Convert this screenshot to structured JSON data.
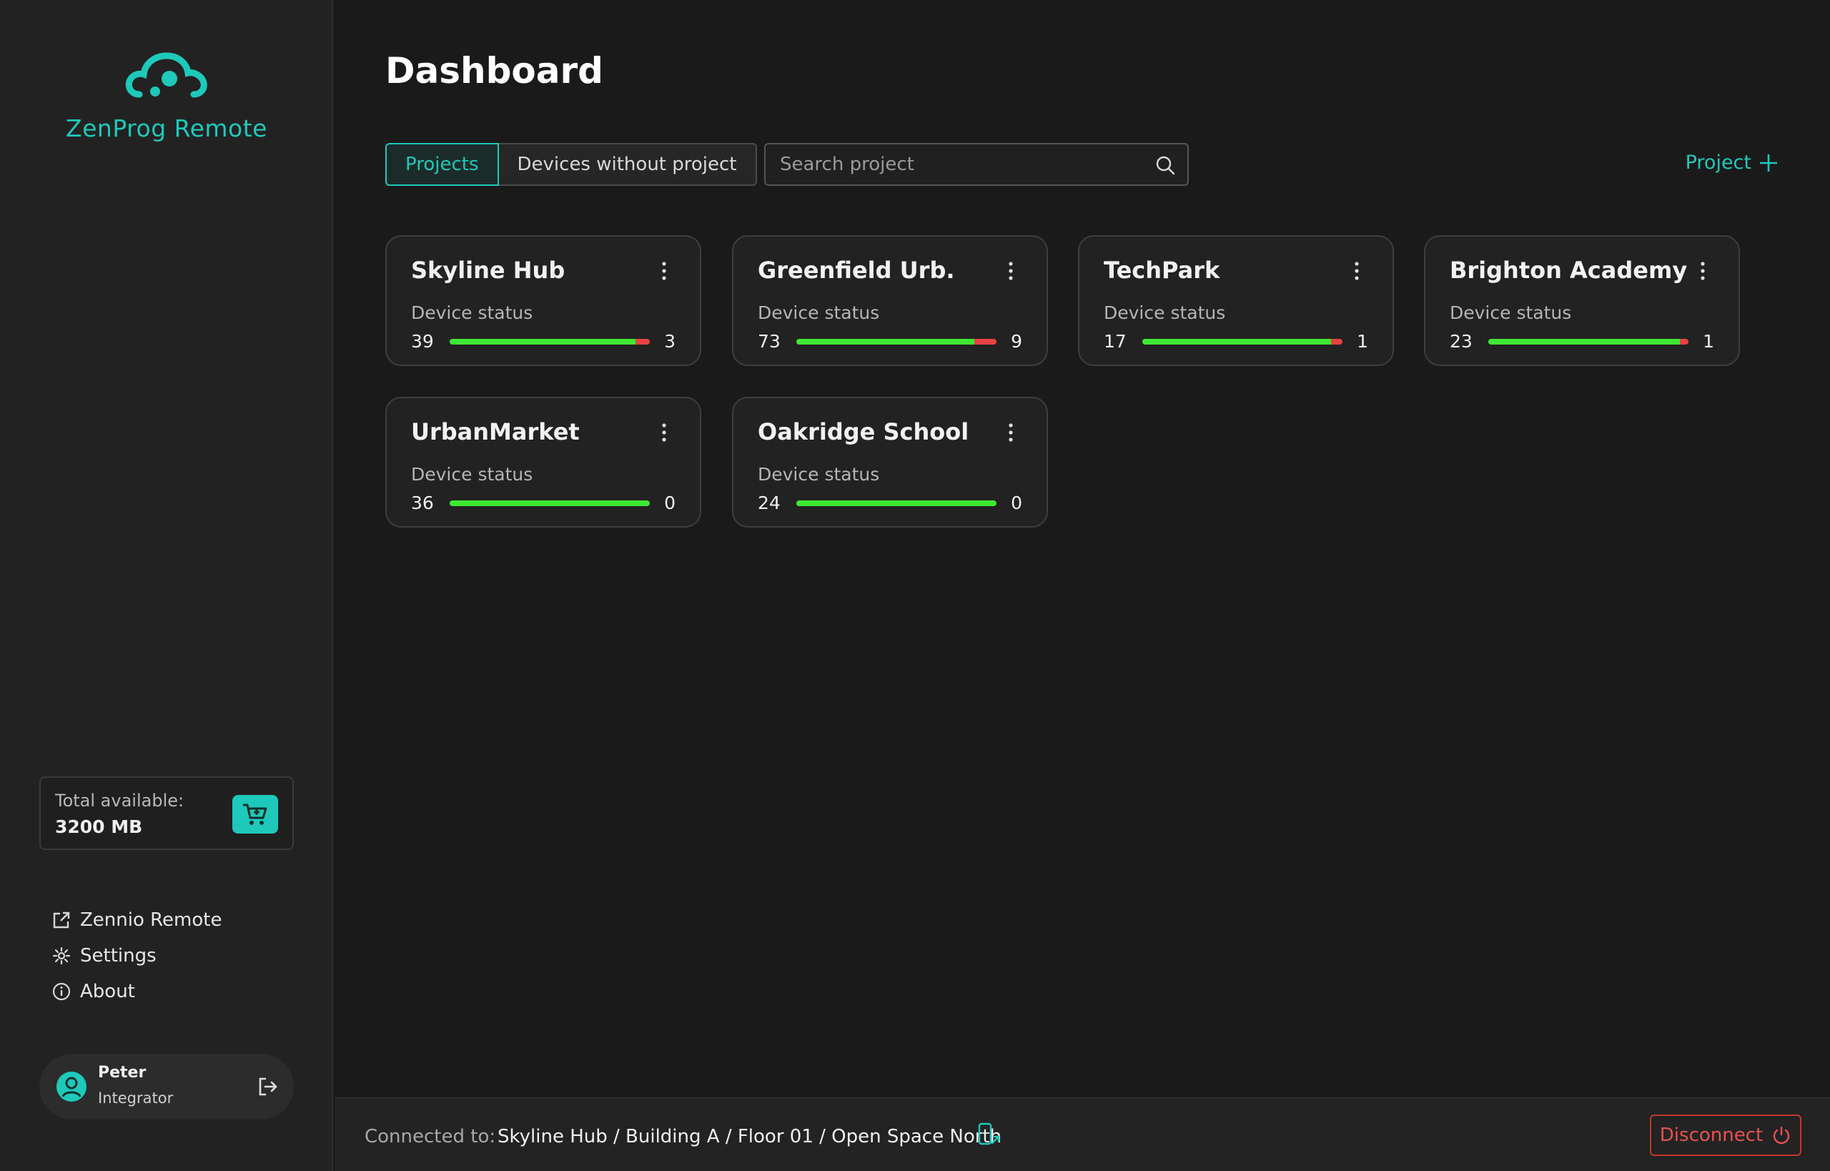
{
  "app": {
    "name": "ZenProg Remote",
    "accent": "#1ec9b9"
  },
  "sidebar": {
    "storage": {
      "label": "Total available:",
      "value": "3200 MB",
      "icon": "cart-icon"
    },
    "nav": [
      {
        "label": "Zennio Remote",
        "icon": "external-link-icon"
      },
      {
        "label": "Settings",
        "icon": "gear-icon"
      },
      {
        "label": "About",
        "icon": "info-icon"
      }
    ],
    "user": {
      "name": "Peter",
      "role": "Integrator"
    }
  },
  "main": {
    "title": "Dashboard",
    "tabs": [
      {
        "label": "Projects",
        "active": true
      },
      {
        "label": "Devices without project",
        "active": false
      }
    ],
    "search": {
      "placeholder": "Search project",
      "value": ""
    },
    "add_project_label": "Project",
    "projects": [
      {
        "name": "Skyline Hub",
        "status_label": "Device status",
        "online": 39,
        "offline": 3
      },
      {
        "name": "Greenfield Urb.",
        "status_label": "Device status",
        "online": 73,
        "offline": 9
      },
      {
        "name": "TechPark",
        "status_label": "Device status",
        "online": 17,
        "offline": 1
      },
      {
        "name": "Brighton Academy",
        "status_label": "Device status",
        "online": 23,
        "offline": 1
      },
      {
        "name": "UrbanMarket",
        "status_label": "Device status",
        "online": 36,
        "offline": 0
      },
      {
        "name": "Oakridge School",
        "status_label": "Device status",
        "online": 24,
        "offline": 0
      }
    ]
  },
  "footer": {
    "connected_label": "Connected to:",
    "connected_path": "Skyline Hub / Building A / Floor 01 / Open Space North",
    "disconnect_label": "Disconnect"
  },
  "colors": {
    "ok": "#3ee832",
    "error": "#e84242",
    "disconnect": "#e85050"
  }
}
